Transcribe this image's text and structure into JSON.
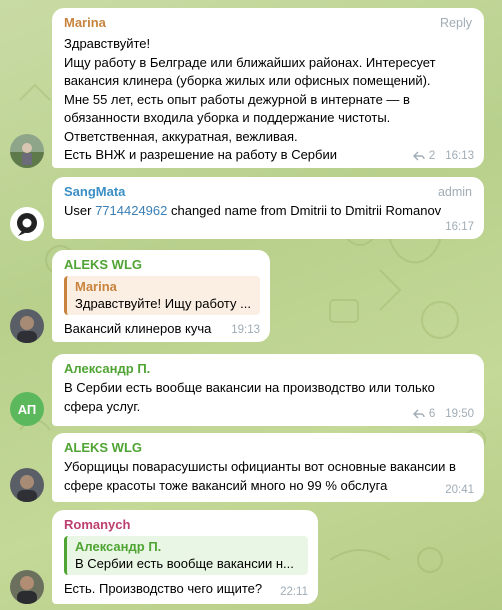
{
  "colors": {
    "marina": "#c8843f",
    "sangmata": "#3a8fc5",
    "aleks": "#4fa433",
    "alexandr": "#4fa433",
    "romanych": "#bc3f6f",
    "avatar_ap": "#5cb85c"
  },
  "messages": [
    {
      "sender": "Marina",
      "reply_label": "Reply",
      "text": "Здравствуйте!\nИщу работу в Белграде или ближайших районах. Интересует вакансия клинера (уборка жилых или офисных помещений).\nМне 55 лет, есть опыт работы дежурной в интернате — в обязанности входила уборка и поддержание чистоты.\nОтветственная, аккуратная, вежливая.\nЕсть ВНЖ и разрешение на работу в Сербии",
      "replies": "2",
      "time": "16:13"
    },
    {
      "sender": "SangMata",
      "badge": "admin",
      "text_pre": "User ",
      "user_id": "7714424962",
      "text_post": " changed name from Dmitrii to Dmitrii Romanov",
      "time": "16:17"
    },
    {
      "sender": "ALEKS WLG",
      "quote_name": "Marina",
      "quote_text": "Здравствуйте! Ищу работу ...",
      "text": "Вакансий клинеров куча",
      "time": "19:13"
    },
    {
      "sender": "Александр П.",
      "avatar_initials": "АП",
      "text": "В Сербии есть вообще вакансии на производство или только сфера услуг.",
      "replies": "6",
      "time": "19:50"
    },
    {
      "sender": "ALEKS WLG",
      "text": "Уборщицы поварасушисты официанты вот основные вакансии в сфере красоты тоже вакансий много но 99 % обслуга",
      "time": "20:41"
    },
    {
      "sender": "Romanych",
      "quote_name": "Александр П.",
      "quote_text": "В Сербии есть вообще вакансии н...",
      "text": "Есть. Производство чего ищите?",
      "time": "22:11"
    }
  ]
}
